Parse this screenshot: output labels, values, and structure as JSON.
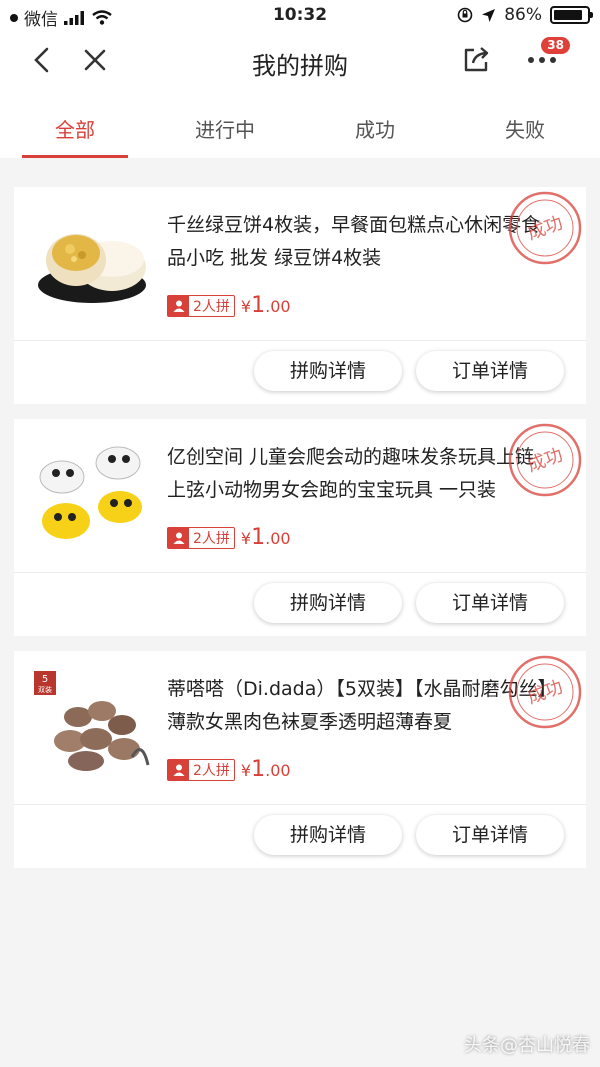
{
  "status_bar": {
    "carrier": "微信",
    "time": "10:32",
    "battery": "86%",
    "battery_level": 0.86
  },
  "header": {
    "title": "我的拼购",
    "more_badge": "38"
  },
  "tabs": [
    {
      "label": "全部"
    },
    {
      "label": "进行中"
    },
    {
      "label": "成功"
    },
    {
      "label": "失败"
    }
  ],
  "orders": [
    {
      "title": "千丝绿豆饼4枚装，早餐面包糕点心休闲零食品小吃 批发 绿豆饼4枚装",
      "group": "2人拼",
      "currency": "¥",
      "price_int": "1",
      "price_dec": ".00",
      "stamp": "成功",
      "btn_group": "拼购详情",
      "btn_order": "订单详情",
      "thumb_icon": "mooncake-image"
    },
    {
      "title": "亿创空间 儿童会爬会动的趣味发条玩具上链上弦小动物男女会跑的宝宝玩具 一只装",
      "group": "2人拼",
      "currency": "¥",
      "price_int": "1",
      "price_dec": ".00",
      "stamp": "成功",
      "btn_group": "拼购详情",
      "btn_order": "订单详情",
      "thumb_icon": "windup-toy-image"
    },
    {
      "title": "蒂嗒嗒（Di.dada）【5双装】【水晶耐磨勾丝】薄款女黑肉色袜夏季透明超薄春夏",
      "group": "2人拼",
      "currency": "¥",
      "price_int": "1",
      "price_dec": ".00",
      "stamp": "成功",
      "btn_group": "拼购详情",
      "btn_order": "订单详情",
      "thumb_icon": "stockings-image",
      "thumb_label_top": "5",
      "thumb_label_bottom": "双装"
    }
  ],
  "watermark": "头条@杏山悦春",
  "colors": {
    "accent": "#d8413a",
    "background": "#f4f4f4"
  }
}
